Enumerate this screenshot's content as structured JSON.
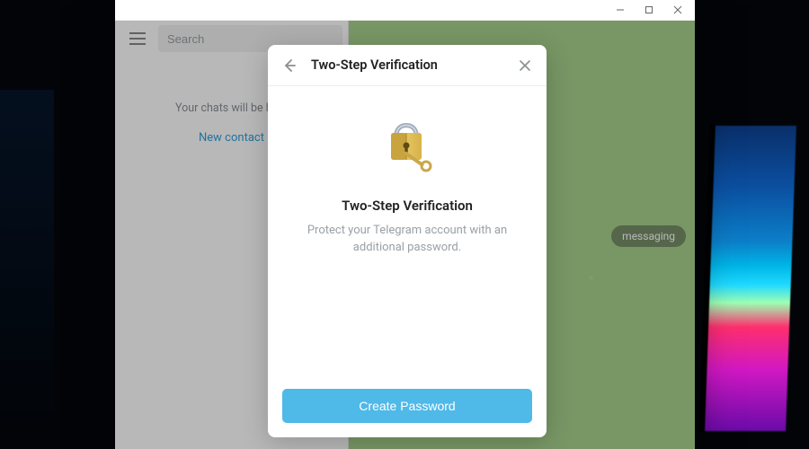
{
  "window_controls": {
    "minimize": "minimize",
    "maximize": "maximize",
    "close": "close"
  },
  "sidebar": {
    "search_placeholder": "Search",
    "empty_label": "Your chats will be here",
    "new_contact_label": "New contact"
  },
  "chat": {
    "badge_text": "messaging"
  },
  "modal": {
    "header_title": "Two-Step Verification",
    "heading": "Two-Step Verification",
    "subtext": "Protect your Telegram account with an additional password.",
    "primary_button": "Create Password"
  },
  "colors": {
    "accent": "#4fb9e8",
    "link": "#2f9fe0",
    "muted": "#9aa0a6"
  }
}
